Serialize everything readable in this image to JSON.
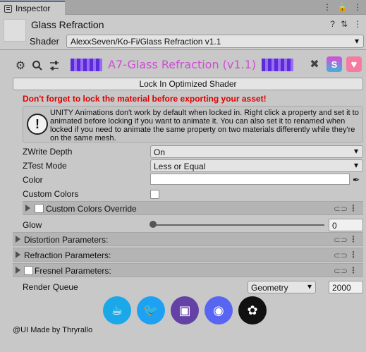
{
  "tab": {
    "label": "Inspector",
    "tools": [
      "⋮",
      "🔒",
      "⋮"
    ]
  },
  "header": {
    "title": "Glass Refraction",
    "shader_label": "Shader",
    "shader_value": "AlexxSeven/Ko-Fi/Glass Refraction v1.1",
    "tools": [
      "?",
      "⇅",
      "⋮"
    ]
  },
  "banner": {
    "title": "A7-Glass Refraction (v1.1)"
  },
  "lock_button": "Lock In Optimized Shader",
  "warning": "Don't forget to lock the material before exporting your asset!",
  "help_text": "UNITY Animations don't work by default when locked in. Right click a property and set it to animated before locking if you want to animate it. You can also set it to renamed when locked if you need to animate the same property on two materials differently while they're on the same mesh.",
  "properties": {
    "zwrite": {
      "label": "ZWrite Depth",
      "value": "On"
    },
    "ztest": {
      "label": "ZTest Mode",
      "value": "Less or Equal"
    },
    "color": {
      "label": "Color",
      "value": "#ffffff"
    },
    "custom_colors": {
      "label": "Custom Colors"
    },
    "custom_colors_override": {
      "label": "Custom Colors Override"
    },
    "glow": {
      "label": "Glow",
      "value": "0"
    },
    "distortion": {
      "label": "Distortion Parameters:"
    },
    "refraction": {
      "label": "Refraction Parameters:"
    },
    "fresnel": {
      "label": "Fresnel Parameters:"
    },
    "render_queue": {
      "label": "Render Queue",
      "mode": "Geometry",
      "value": "2000"
    }
  },
  "icons": {
    "toolbar": [
      "gear-icon",
      "search-icon",
      "sliders-icon"
    ],
    "right": [
      "tools-icon",
      "shader-icon",
      "heart-icon"
    ],
    "socials": [
      "ko-fi-icon",
      "twitter-icon",
      "twitch-icon",
      "discord-icon",
      "vrchat-icon"
    ]
  },
  "colors": {
    "banner_title": "#cf4bd6",
    "warning": "#e00000",
    "kofi": "#1ba8e8",
    "twitter": "#1da1f2",
    "twitch": "#6441a5",
    "discord": "#5865f2",
    "vrchat": "#111111"
  },
  "footer": "@UI Made by Thryrallo"
}
